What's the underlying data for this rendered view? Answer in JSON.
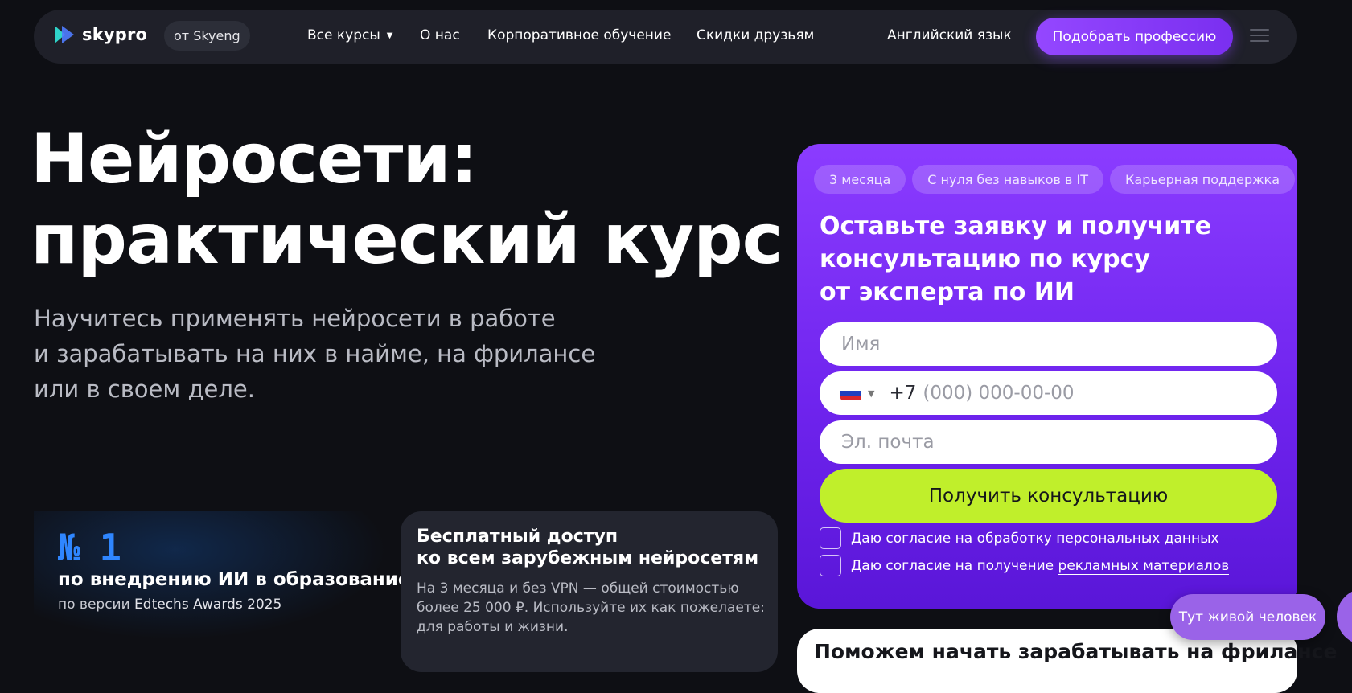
{
  "header": {
    "logo_text": "skypro",
    "from_badge": "от Skyeng",
    "nav": {
      "all_courses": "Все курсы",
      "about": "О нас",
      "corporate": "Корпоративное обучение",
      "discounts": "Скидки друзьям",
      "english": "Английский язык"
    },
    "cta": "Подобрать профессию"
  },
  "hero": {
    "title_line1": "Нейросети:",
    "title_line2": "практический курс",
    "subtitle_line1": "Научитесь применять нейросети в работе",
    "subtitle_line2": "и зарабатывать на них в найме, на фрилансе",
    "subtitle_line3": "или в своем деле."
  },
  "award": {
    "number": "№ 1",
    "title": "по внедрению ИИ в образование",
    "sub_prefix": "по версии ",
    "sub_link": "Edtechs Awards 2025"
  },
  "free_card": {
    "title_line1": "Бесплатный доступ",
    "title_line2": "ко всем зарубежным нейросетям",
    "text": "На 3 месяца и без VPN — общей стоимостью более 25 000 ₽. Используйте их как пожелаете: для работы и жизни."
  },
  "form": {
    "tags": [
      "3 месяца",
      "С нуля без навыков в IT",
      "Карьерная поддержка"
    ],
    "title_line1": "Оставьте заявку и получите",
    "title_line2": "консультацию по курсу",
    "title_line3": "от эксперта по ИИ",
    "name_placeholder": "Имя",
    "phone_code": "+7",
    "phone_placeholder": "(000) 000-00-00",
    "email_placeholder": "Эл. почта",
    "submit": "Получить консультацию",
    "consent1_prefix": "Даю согласие на обработку ",
    "consent1_link": "персональных данных",
    "consent2_prefix": "Даю согласие на получение ",
    "consent2_link": "рекламных материалов"
  },
  "next_card": {
    "title": "Поможем начать зарабатывать на фрилансе"
  },
  "live_button": "Тут живой человек",
  "colors": {
    "accent_purple": "#8b3cff",
    "accent_lime": "#c0ef2b",
    "award_blue": "#2f86ff",
    "background": "#0e0f14"
  }
}
